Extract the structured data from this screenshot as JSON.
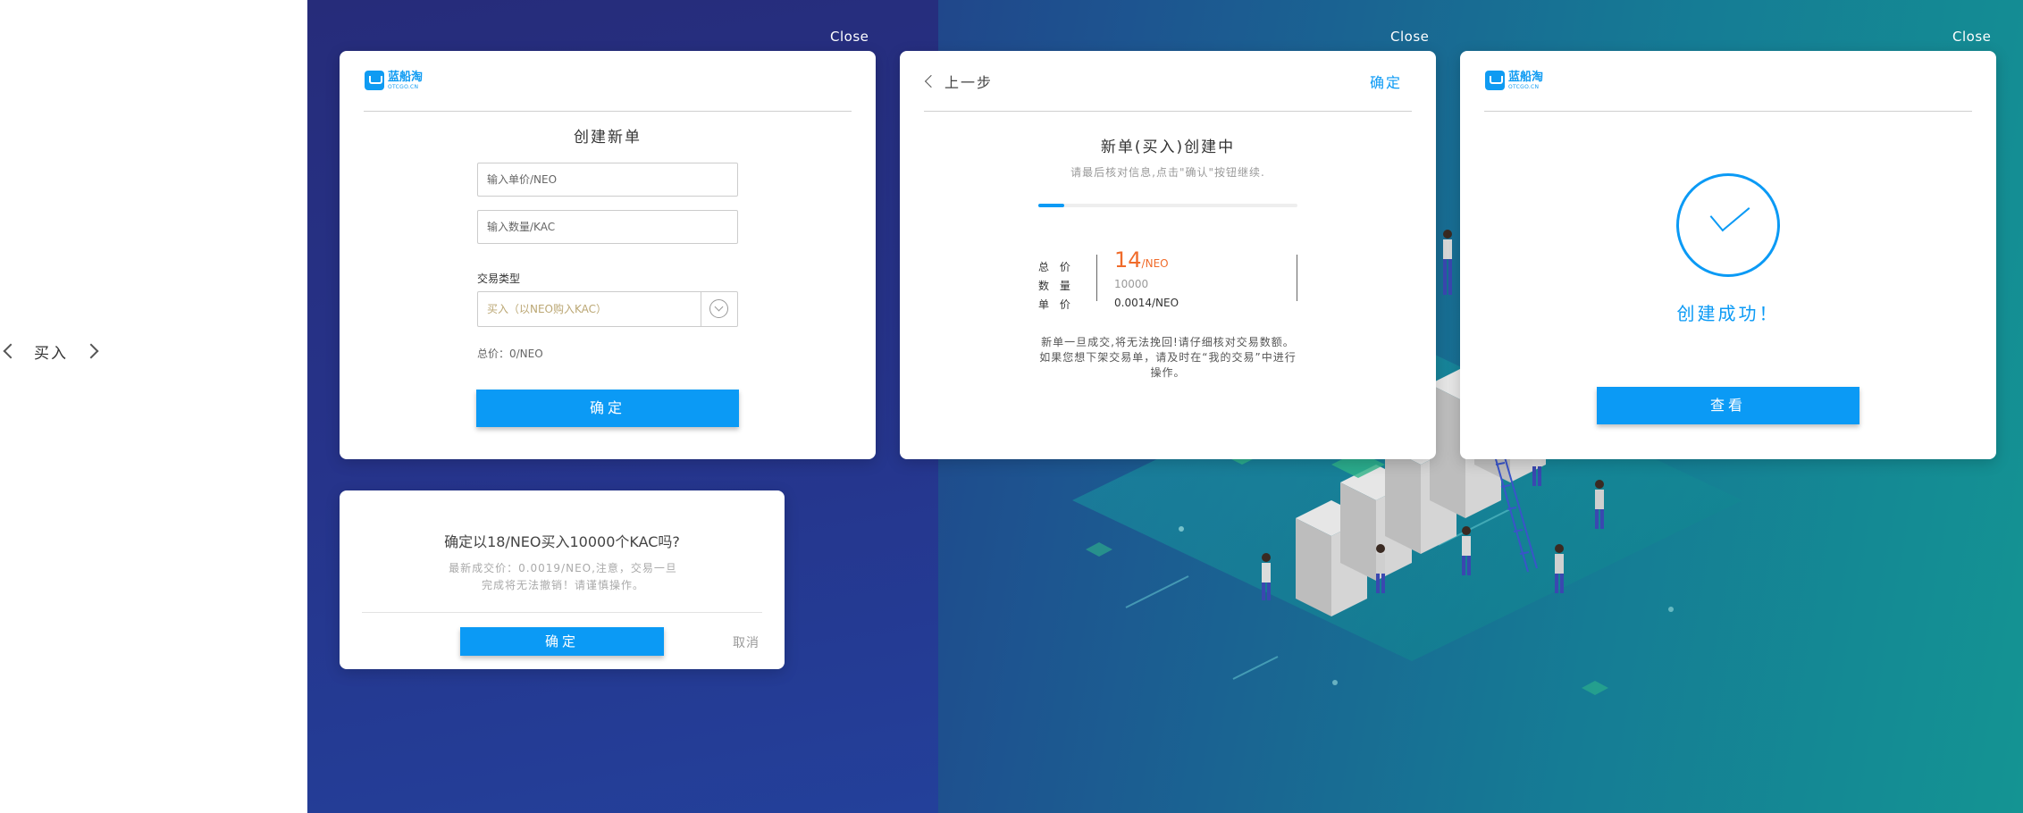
{
  "side": {
    "label": "买入"
  },
  "close_label": "Close",
  "logo": {
    "name": "蓝船淘",
    "sub": "OTCGO.CN"
  },
  "create_card": {
    "title": "创建新单",
    "price_placeholder": "输入单价/NEO",
    "qty_placeholder": "输入数量/KAC",
    "type_label": "交易类型",
    "type_value": "买入（以NEO购入KAC）",
    "total": "总价：0/NEO",
    "confirm": "确定"
  },
  "review_card": {
    "back": "上一步",
    "confirm": "确定",
    "title": "新单(买入)创建中",
    "subtitle": "请最后核对信息,点击\"确认\"按钮继续.",
    "progress": 0.1,
    "total_label": "总 价",
    "qty_label": "数 量",
    "unit_label": "单 价",
    "total_value": "14",
    "total_unit": "/NEO",
    "qty_value": "10000",
    "unit_value": "0.0014/NEO",
    "note_1": "新单一旦成交,将无法挽回!请仔细核对交易数额。",
    "note_2": "如果您想下架交易单，请及时在“我的交易”中进行",
    "note_3": "操作。"
  },
  "success_card": {
    "message": "创建成功！",
    "view": "查看"
  },
  "dialog": {
    "title": "确定以18/NEO买入10000个KAC吗?",
    "sub_1": "最新成交价：0.0019/NEO,注意，交易一旦",
    "sub_2": "完成将无法撤销！请谨慎操作。",
    "confirm": "确定",
    "cancel": "取消"
  },
  "colors": {
    "accent": "#0b9af5",
    "price": "#f06b2a"
  }
}
